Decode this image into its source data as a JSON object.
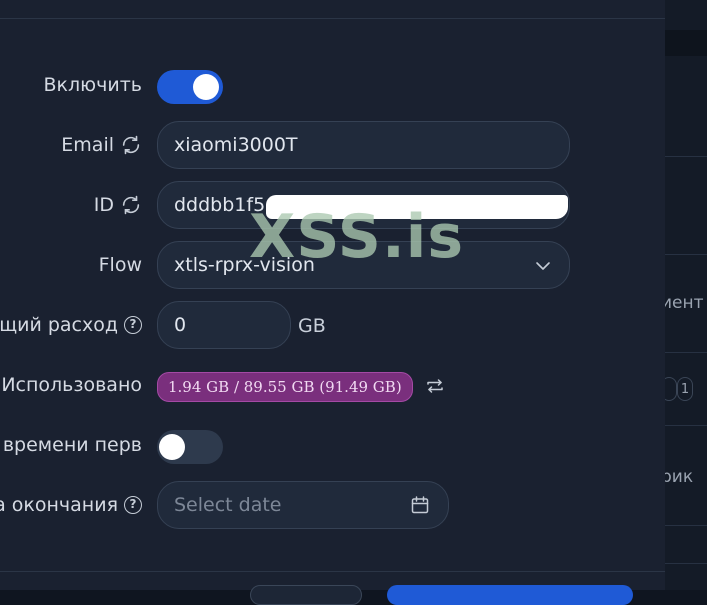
{
  "form": {
    "enable_label": "Включить",
    "enable_on": true,
    "email_label": "Email",
    "email_value": "xiaomi3000T",
    "id_label": "ID",
    "id_value": "dddbb1f5",
    "flow_label": "Flow",
    "flow_value": "xtls-rprx-vision",
    "total_label": "щий расход",
    "total_value": "0",
    "total_unit": "GB",
    "used_label": "Использовано",
    "used_value": "1.94 GB / 89.55 GB (91.49 GB)",
    "first_use_label": "со времени перв",
    "first_use_on": false,
    "expiry_label": "а окончания",
    "expiry_placeholder": "Select date"
  },
  "watermark": "XSS.is",
  "background": {
    "col_header": "иент",
    "row_text": "рик",
    "pill_1": "1"
  },
  "colors": {
    "modal_bg": "#1a2130",
    "toggle_on": "#1f5ad6",
    "usage_badge": "#7a2f7d"
  },
  "icons": {
    "email_sync": "sync-icon",
    "id_sync": "sync-icon",
    "flow_chevron": "chevron-down-icon",
    "used_reset": "repeat-icon",
    "expiry_calendar": "calendar-icon",
    "help": "question-circle-icon"
  }
}
